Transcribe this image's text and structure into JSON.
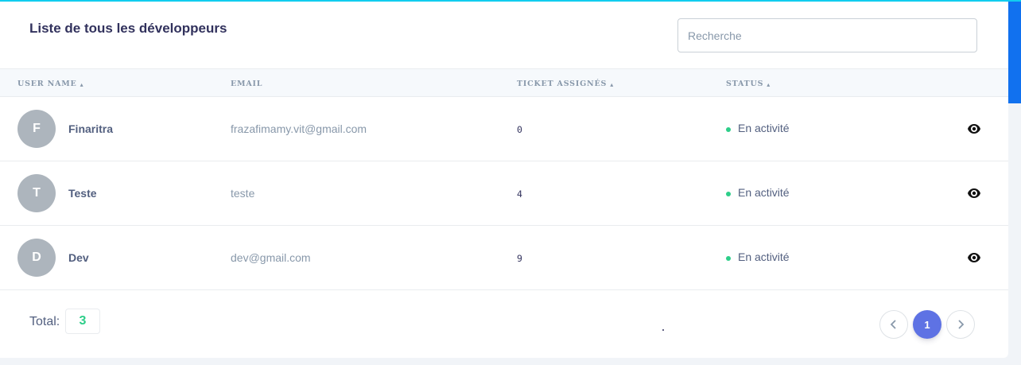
{
  "header": {
    "title": "Liste de tous les développeurs",
    "search_placeholder": "Recherche"
  },
  "table": {
    "columns": [
      {
        "label": "USER NAME",
        "sortable": true
      },
      {
        "label": "EMAIL",
        "sortable": false
      },
      {
        "label": "TICKET ASSIGNÉS",
        "sortable": true
      },
      {
        "label": "STATUS",
        "sortable": true
      }
    ],
    "rows": [
      {
        "initial": "F",
        "name": "Finaritra",
        "email": "frazafimamy.vit@gmail.com",
        "tickets": "0",
        "status": "En activité",
        "action_icon": "eye-icon"
      },
      {
        "initial": "T",
        "name": "Teste",
        "email": "teste",
        "tickets": "4",
        "status": "En activité",
        "action_icon": "eye-icon"
      },
      {
        "initial": "D",
        "name": "Dev",
        "email": "dev@gmail.com",
        "tickets": "9",
        "status": "En activité",
        "action_icon": "eye-icon"
      }
    ]
  },
  "footer": {
    "total_label": "Total:",
    "total_value": "3",
    "pagination": {
      "prev_icon": "chevron-left-icon",
      "current_page": "1",
      "next_icon": "chevron-right-icon"
    }
  },
  "colors": {
    "accent": "#5e72e4",
    "status_active": "#2dce89",
    "top_bar": "#11cdef",
    "scroll_accent": "#1171ef"
  }
}
